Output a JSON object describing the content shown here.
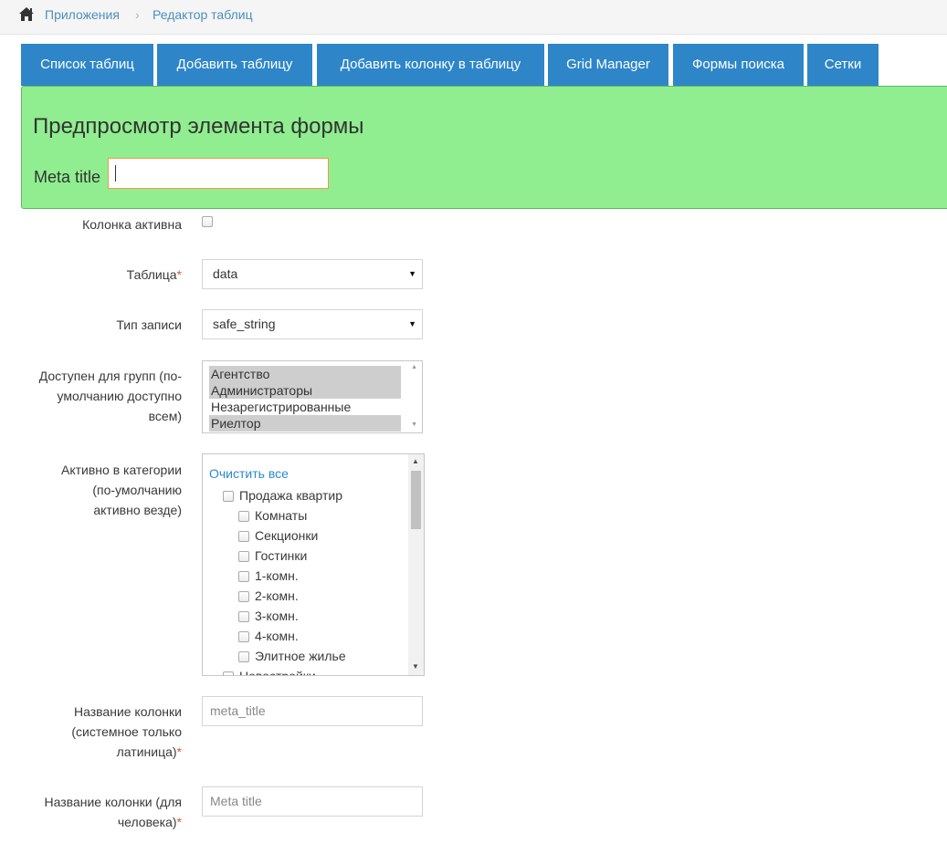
{
  "breadcrumb": {
    "items": [
      "Приложения",
      "Редактор таблиц"
    ],
    "separator": "›"
  },
  "tabs": [
    {
      "label": "Список таблиц"
    },
    {
      "label": "Добавить таблицу"
    },
    {
      "label": "Добавить колонку в таблицу"
    },
    {
      "label": "Grid Manager"
    },
    {
      "label": "Формы поиска"
    },
    {
      "label": "Сетки"
    }
  ],
  "preview": {
    "title": "Предпросмотр элемента формы",
    "field_label": "Meta title",
    "field_value": ""
  },
  "form": {
    "active_label": "Колонка активна",
    "table_label": "Таблица",
    "table_value": "data",
    "record_type_label": "Тип записи",
    "record_type_value": "safe_string",
    "groups_label_l1": "Доступен для групп (по-",
    "groups_label_l2": "умолчанию доступно",
    "groups_label_l3": "всем)",
    "groups": [
      {
        "label": "Агентство",
        "selected": true
      },
      {
        "label": "Администраторы",
        "selected": true
      },
      {
        "label": "Незарегистрированные",
        "selected": false
      },
      {
        "label": "Риелтор",
        "selected": true
      }
    ],
    "category_label_l1": "Активно в категории",
    "category_label_l2": "(по-умолчанию",
    "category_label_l3": "активно везде)",
    "clear_all": "Очистить все",
    "categories": [
      {
        "label": "Продажа квартир",
        "level": 0
      },
      {
        "label": "Комнаты",
        "level": 1
      },
      {
        "label": "Секционки",
        "level": 1
      },
      {
        "label": "Гостинки",
        "level": 1
      },
      {
        "label": "1-комн.",
        "level": 1
      },
      {
        "label": "2-комн.",
        "level": 1
      },
      {
        "label": "3-комн.",
        "level": 1
      },
      {
        "label": "4-комн.",
        "level": 1
      },
      {
        "label": "Элитное жилье",
        "level": 1
      },
      {
        "label": "Новостройки",
        "level": 0
      }
    ],
    "sysname_label_l1": "Название колонки",
    "sysname_label_l2": "(системное только",
    "sysname_label_l3": "латиница)",
    "sysname_value": "meta_title",
    "humanname_label_l1": "Название колонки (для",
    "humanname_label_l2": "человека)",
    "humanname_value": "Meta title",
    "required_mark": "*"
  },
  "colors": {
    "tab_bg": "#2e86c9",
    "preview_bg": "#90ee90",
    "link": "#2a8bcc",
    "required": "#d15b47"
  },
  "icons": {
    "home": "home-icon",
    "select_arrow": "caret-down-icon"
  }
}
